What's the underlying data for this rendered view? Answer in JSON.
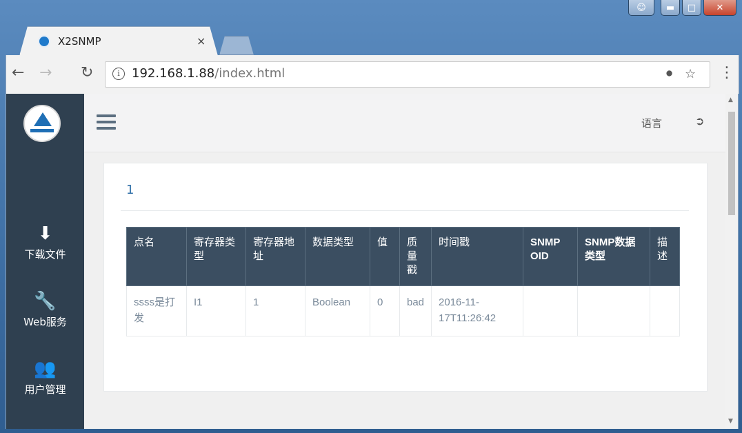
{
  "browser": {
    "tab_title": "X2SNMP",
    "tab_close": "×",
    "url_host": "192.168.1.88",
    "url_path": "/index.html"
  },
  "sidebar": {
    "items": [
      {
        "label": "下载文件",
        "icon": "download-icon"
      },
      {
        "label": "Web服务",
        "icon": "wrench-icon"
      },
      {
        "label": "用户管理",
        "icon": "users-icon"
      }
    ]
  },
  "header": {
    "language_label": "语言"
  },
  "panel": {
    "title": "1"
  },
  "table": {
    "headers": [
      "点名",
      "寄存器类型",
      "寄存器地址",
      "数据类型",
      "值",
      "质量戳",
      "时间戳",
      "SNMP OID",
      "SNMP数据类型",
      "描述"
    ],
    "rows": [
      [
        "ssss是打发",
        "I1",
        "1",
        "Boolean",
        "0",
        "bad",
        "2016-11-17T11:26:42",
        "",
        "",
        ""
      ]
    ]
  },
  "colors": {
    "sidebar_bg": "#2f4050",
    "table_header_bg": "#3b4e61",
    "title_accent": "#2f6fa8"
  }
}
